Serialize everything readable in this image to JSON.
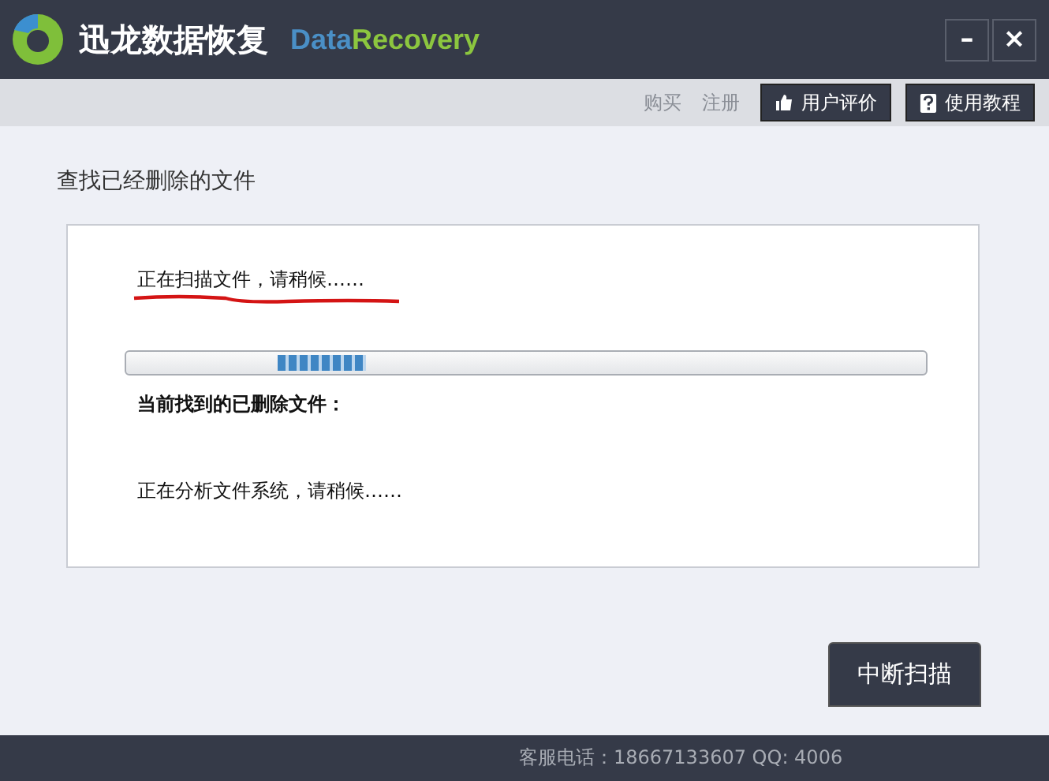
{
  "window": {
    "title": "迅龙数据恢复",
    "subtitle_parts": [
      "Data",
      "Recovery"
    ],
    "controls": [
      "–",
      "×"
    ]
  },
  "toolbar": {
    "links": [
      "购买",
      "注册"
    ],
    "buttons": [
      {
        "label": "用户评价",
        "kind": "thumb"
      },
      {
        "label": "使用教程",
        "kind": "help"
      }
    ]
  },
  "heading": "查找已经删除的文件",
  "panel": {
    "level": 0.3,
    "status": "正在扫描文件，请稍候……",
    "found_label": "当前找到的已删除文件：",
    "detail": "正在分析文件系统，请稍候……"
  },
  "stop_button": "中断扫描",
  "status_bar": "客服电话：18667133607 QQ: 4006"
}
